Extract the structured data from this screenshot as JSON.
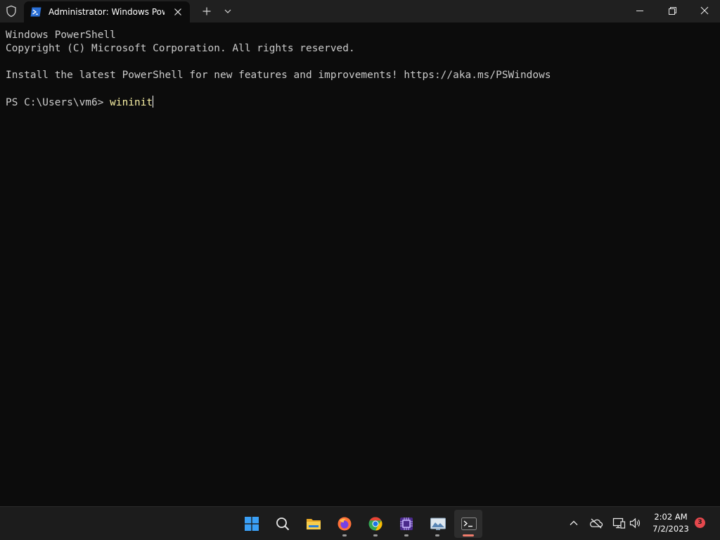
{
  "window": {
    "tab_title": "Administrator: Windows PowerShell"
  },
  "terminal": {
    "lines": [
      "Windows PowerShell",
      "Copyright (C) Microsoft Corporation. All rights reserved.",
      "",
      "Install the latest PowerShell for new features and improvements! https://aka.ms/PSWindows",
      ""
    ],
    "prompt": "PS C:\\Users\\vm6> ",
    "command": "wininit"
  },
  "taskbar": {
    "apps": [
      {
        "name": "start-icon",
        "running": false
      },
      {
        "name": "search-icon",
        "running": false
      },
      {
        "name": "file-explorer-icon",
        "running": false
      },
      {
        "name": "firefox-icon",
        "running": true
      },
      {
        "name": "chrome-icon",
        "running": true
      },
      {
        "name": "chip-app-icon",
        "running": true
      },
      {
        "name": "image-viewer-icon",
        "running": true
      },
      {
        "name": "terminal-icon",
        "running": true,
        "active": true
      }
    ],
    "clock": {
      "time": "2:02 AM",
      "date": "7/2/2023"
    },
    "notification_count": "3"
  },
  "colors": {
    "terminal_bg": "#0c0c0c",
    "terminal_text": "#cccccc",
    "command_text": "#f9f1a5",
    "titlebar_bg": "#202020",
    "taskbar_bg": "#1c1c1c",
    "active_indicator": "#f07c6c",
    "badge": "#e5484d"
  }
}
